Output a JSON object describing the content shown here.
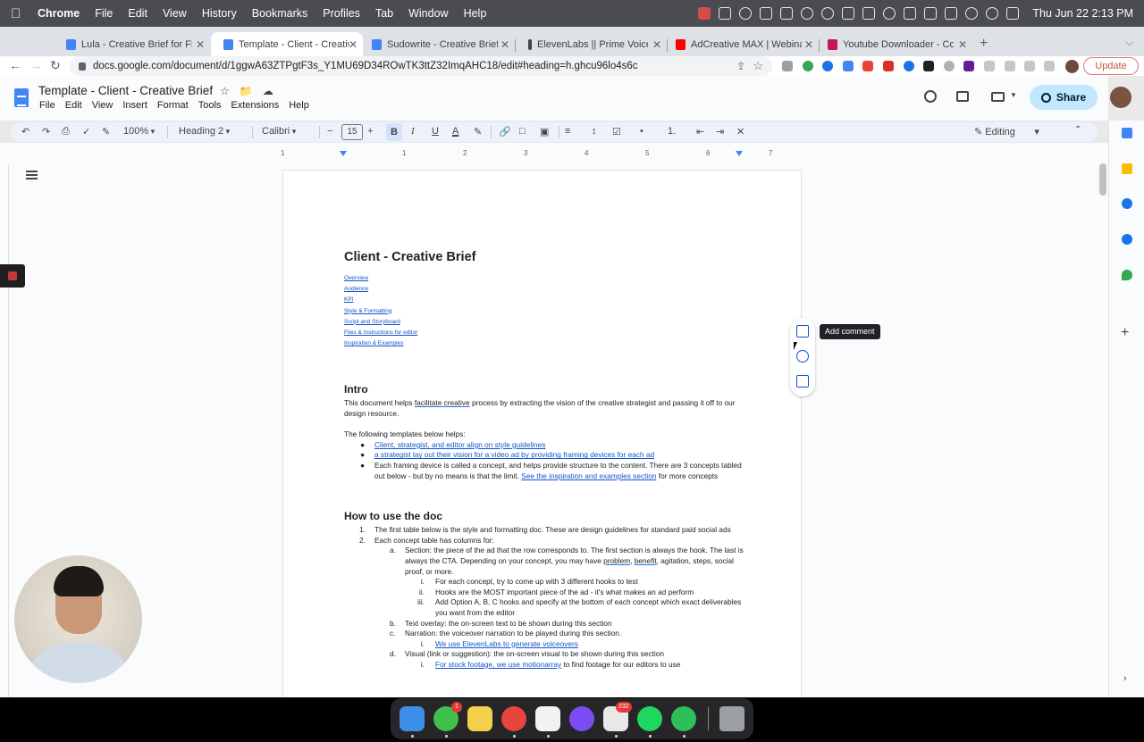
{
  "os_menu": {
    "app": "Chrome",
    "items": [
      "File",
      "Edit",
      "View",
      "History",
      "Bookmarks",
      "Profiles",
      "Tab",
      "Window",
      "Help"
    ],
    "clock": "Thu Jun 22  2:13 PM"
  },
  "browser": {
    "tabs": [
      {
        "title": "Lula - Creative Brief for FB ads",
        "favicon_color": "#4285f4"
      },
      {
        "title": "Template - Client - Creative Brief",
        "favicon_color": "#4285f4"
      },
      {
        "title": "Sudowrite - Creative Brief - Go",
        "favicon_color": "#4285f4"
      },
      {
        "title": "ElevenLabs || Prime Voice AI",
        "favicon_color": "#444444"
      },
      {
        "title": "AdCreative MAX | Webinar Rep",
        "favicon_color": "#ff0000"
      },
      {
        "title": "Youtube Downloader - Convert",
        "favicon_color": "#c2185b"
      }
    ],
    "new_tab_glyph": "+",
    "tab_close_glyph": "✕",
    "url": "docs.google.com/document/d/1ggwA63ZTPgtF3s_Y1MU69D34ROwTK3ttZ32ImqAHC18/edit#heading=h.ghcu96lo4s6c",
    "update_label": "Update"
  },
  "docs": {
    "title": "Template - Client - Creative Brief",
    "menu": [
      "File",
      "Edit",
      "View",
      "Insert",
      "Format",
      "Tools",
      "Extensions",
      "Help"
    ],
    "share_label": "Share",
    "toolbar": {
      "zoom": "100%",
      "style": "Heading 2",
      "font": "Calibri",
      "font_size": "15",
      "bold": "B",
      "italic": "I",
      "underline": "U",
      "text_color": "A",
      "mode": "Editing"
    },
    "ruler_numbers": [
      "1",
      "1",
      "2",
      "3",
      "4",
      "5",
      "6",
      "7"
    ],
    "tooltip": "Add comment"
  },
  "doc": {
    "heading": "Client - Creative Brief",
    "toc": [
      "Overview",
      "Audience",
      "KPI",
      "Style & Formatting",
      "Script and Storyboard",
      "Files & Instructions for editor",
      "Inspiration & Examples"
    ],
    "intro": {
      "heading": "Intro",
      "p1_a": "This document helps ",
      "p1_b": "facilitate creative",
      "p1_c": " process by extracting the vision of the creative strategist and passing it off to our design resource.",
      "p2": "The following templates below helps:",
      "bullet1": "Client, strategist, and editor align on style guidelines",
      "bullet2": "a strategist lay out their vision for a video ad by providing framing devices for each ad",
      "bullet3_a": "Each framing device is called a concept, and helps provide structure to the content. There are 3 concepts tabled out below - but by no means is that the limit. ",
      "bullet3_link": "See the inspiration and examples section",
      "bullet3_b": " for more concepts"
    },
    "howto": {
      "heading": "How to use the doc",
      "item1": "The first table below is the style and formatting doc. These are design guidelines for standard paid social ads",
      "item2": "Each concept table has columns for:",
      "a": "Section: the piece of the ad that the row corresponds to. The first section is always the hook. The last is always the CTA. Depending on your concept, you may have ",
      "a_u1": "problem",
      "a_sep": ", ",
      "a_u2": "benefit",
      "a_end": ", agitation, steps, social proof, or more.",
      "a_i": "For each concept, try to come up with 3 different hooks to test",
      "a_ii": "Hooks are the MOST important piece of the ad - it's what makes an ad perform",
      "a_iii": "Add Option A, B, C hooks and specify at the bottom of each concept which exact deliverables you want from the editor",
      "b": "Text overlay: the on-screen text to be shown during this section",
      "c": "Narration: the voiceover narration to be played during this section.",
      "c_i": "We use ElevenLabs to generate voiceovers",
      "d": "Visual (link or suggestion): the on-screen visual to be shown during this section",
      "d_i_a": "For stock footage, we use ",
      "d_i_link": "motionarray",
      "d_i_b": " to find footage for our editors to use",
      "markers": {
        "n1": "1.",
        "n2": "2.",
        "a": "a.",
        "b": "b.",
        "c": "c.",
        "d": "d.",
        "i": "i.",
        "ii": "ii.",
        "iii": "iii.",
        "bullet": "●"
      }
    }
  },
  "dock": {
    "apps": [
      {
        "name": "Finder",
        "color": "#3d8ee8"
      },
      {
        "name": "Messages",
        "color": "#3fc04a",
        "badge": "1"
      },
      {
        "name": "Notes",
        "color": "#f5d04b"
      },
      {
        "name": "Chrome",
        "color": "#e8453c"
      },
      {
        "name": "Notion",
        "color": "#f2f2f2"
      },
      {
        "name": "Messenger",
        "color": "#7b4cf2"
      },
      {
        "name": "Slack",
        "color": "#e8e8e8",
        "badge": "232"
      },
      {
        "name": "Spotify",
        "color": "#1ed760"
      },
      {
        "name": "WhatsApp",
        "color": "#2fbf58"
      },
      {
        "name": "Trash",
        "color": "#9aa0a6"
      }
    ]
  }
}
